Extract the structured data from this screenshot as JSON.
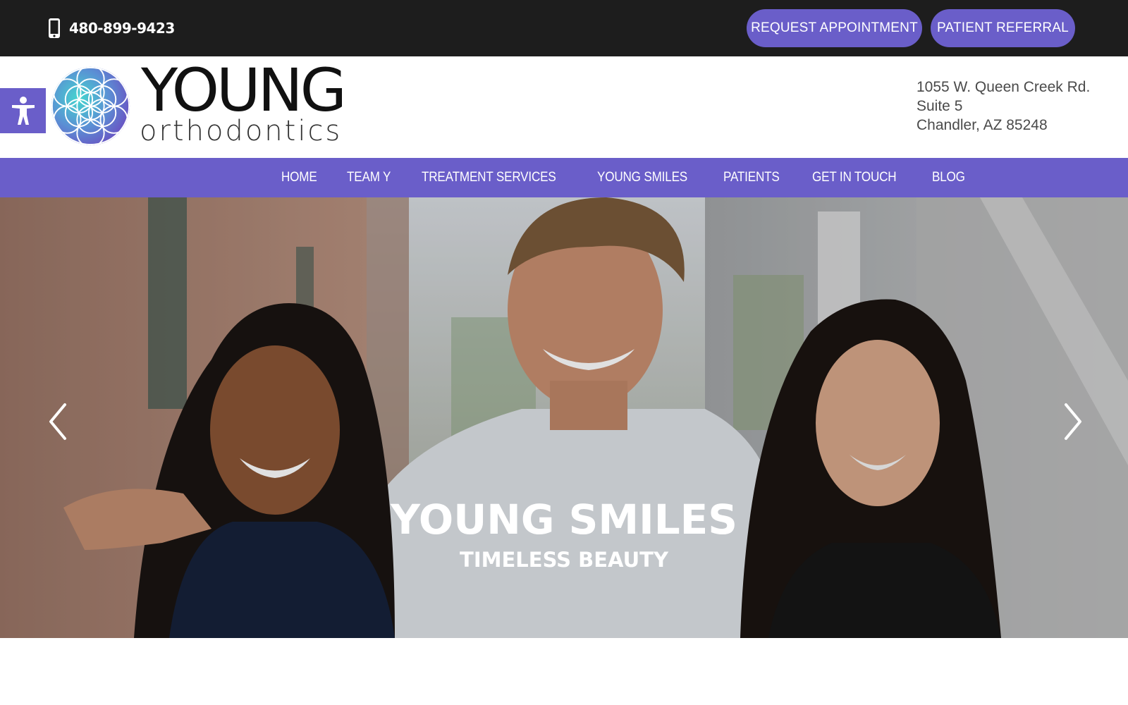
{
  "topbar": {
    "phone": "480-899-9423",
    "phone_icon": "mobile-phone-icon",
    "request_appointment": "REQUEST APPOINTMENT",
    "patient_referral": "PATIENT REFERRAL",
    "button_color": "#6a5ec9",
    "background": "#1d1d1d"
  },
  "header": {
    "accessibility_icon": "accessibility-icon",
    "logo": {
      "name": "YOUNG",
      "tagline": "orthodontics"
    },
    "address": {
      "line1": "1055 W. Queen Creek Rd.",
      "line2": "Suite 5",
      "line3": "Chandler, AZ 85248"
    }
  },
  "nav": {
    "background": "#6a5ec9",
    "items": [
      {
        "label": "HOME"
      },
      {
        "label": "TEAM Y"
      },
      {
        "label": "TREATMENT SERVICES"
      },
      {
        "label": "YOUNG SMILES"
      },
      {
        "label": "PATIENTS"
      },
      {
        "label": "GET IN TOUCH"
      },
      {
        "label": "BLOG"
      }
    ]
  },
  "hero": {
    "title": "YOUNG SMILES",
    "subtitle": "TIMELESS BEAUTY",
    "prev_icon": "chevron-left-icon",
    "next_icon": "chevron-right-icon"
  }
}
